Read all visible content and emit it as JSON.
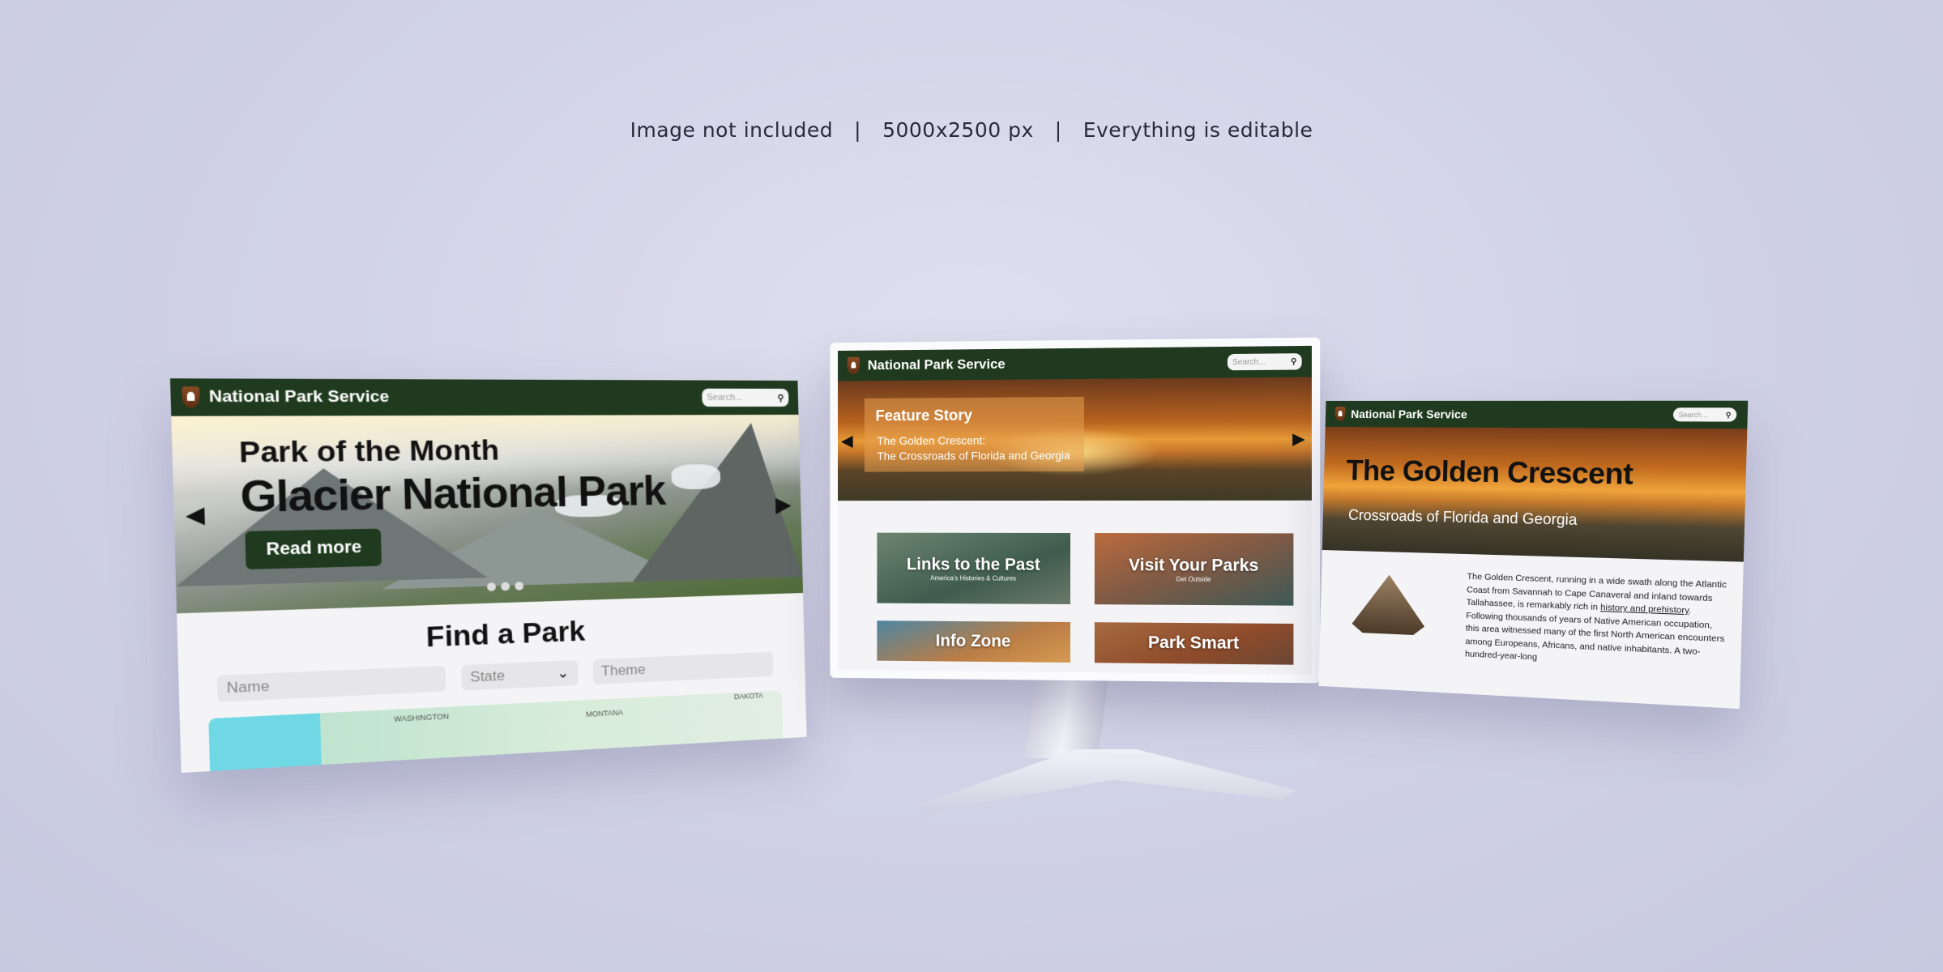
{
  "caption": {
    "part1": "Image not included",
    "sep": "|",
    "part2": "5000x2500 px",
    "part3": "Everything is editable"
  },
  "brand": {
    "title": "National Park Service",
    "search_placeholder": "Search...",
    "header_color": "#1f3a1e"
  },
  "left_screen": {
    "kicker": "Park of the Month",
    "headline": "Glacier National Park",
    "read_more": "Read more",
    "prev_arrow": "◀",
    "next_arrow": "▶",
    "find_title": "Find a Park",
    "fields": {
      "name_placeholder": "Name",
      "state_value": "State",
      "theme_placeholder": "Theme"
    },
    "map_labels": [
      "WASHINGTON",
      "MONTANA",
      "DAKOTA"
    ]
  },
  "center_screen": {
    "feature_title": "Feature Story",
    "feature_line1": "The Golden Crescent:",
    "feature_line2": "The Crossroads of Florida and Georgia",
    "prev_arrow": "◀",
    "next_arrow": "▶",
    "cards": [
      {
        "title": "Links to the Past",
        "subtitle": "America's Histories & Cultures"
      },
      {
        "title": "Visit Your Parks",
        "subtitle": "Get Outside"
      },
      {
        "title": "Info Zone",
        "subtitle": ""
      },
      {
        "title": "Park Smart",
        "subtitle": ""
      }
    ]
  },
  "right_screen": {
    "title": "The Golden Crescent",
    "subtitle": "Crossroads of Florida and Georgia",
    "article_part1": "The Golden Crescent, running in a wide swath along the Atlantic Coast from Savannah to Cape Canaveral and inland towards Tallahassee, is remarkably rich in ",
    "article_link": "history and prehistory",
    "article_part2": ". Following thousands of years of Native American occupation, this area witnessed many of the first North American encounters among Europeans, Africans, and native inhabitants. A two-hundred-year-long"
  }
}
